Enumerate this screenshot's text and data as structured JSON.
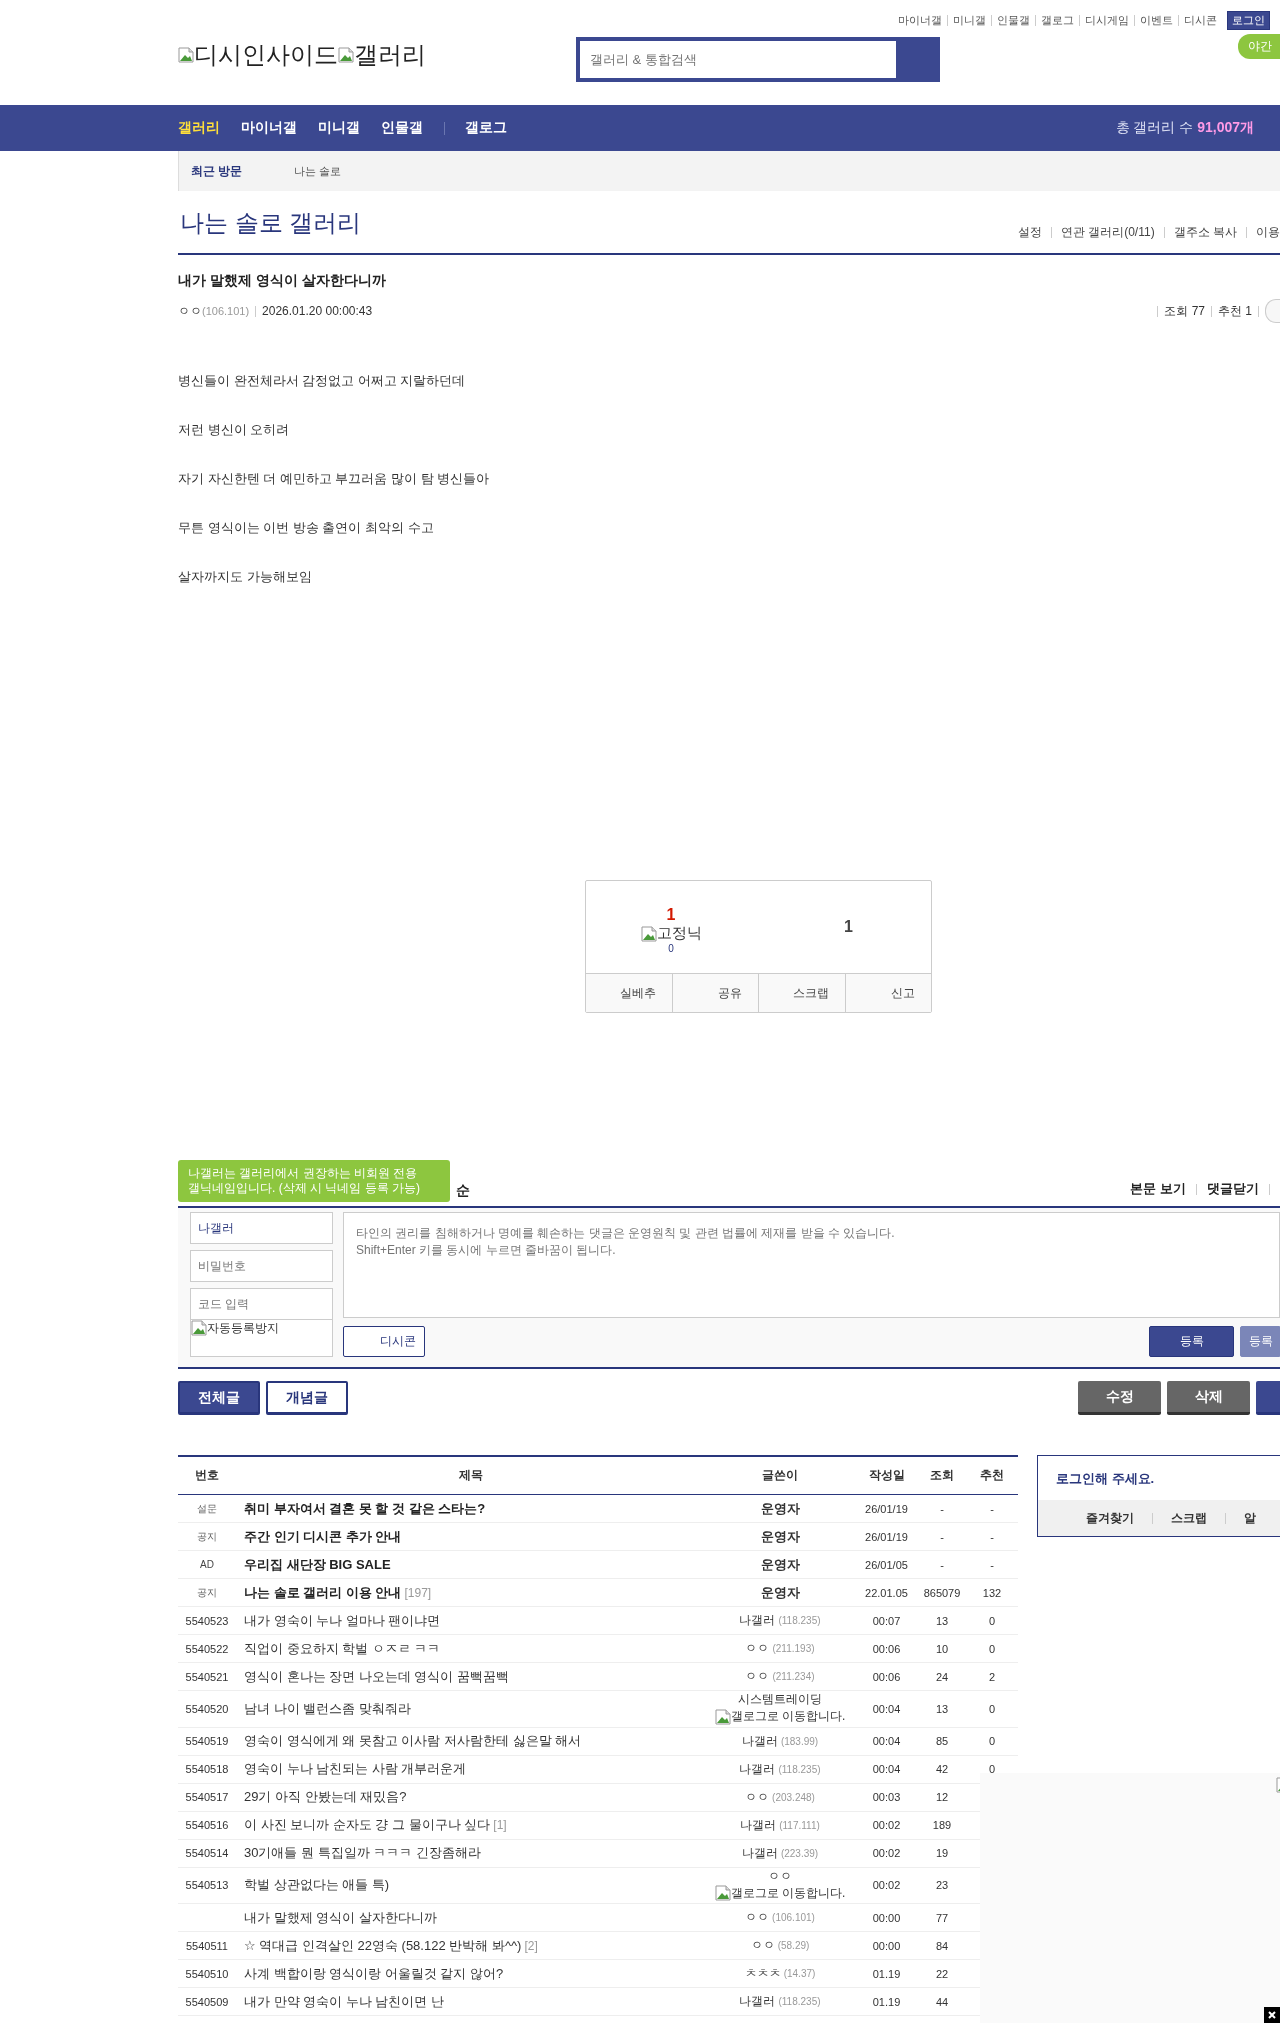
{
  "top_links": [
    {
      "label": "마이너갤"
    },
    {
      "label": "미니갤"
    },
    {
      "label": "인물갤"
    },
    {
      "label": "갤로그"
    },
    {
      "label": "디시게임"
    },
    {
      "label": "이벤트"
    },
    {
      "label": "디시콘"
    }
  ],
  "login_button": "로그인",
  "logo": {
    "site": "디시인사이드",
    "section": "갤러리"
  },
  "search": {
    "placeholder": "갤러리 & 통합검색"
  },
  "night_mode_button": "야간",
  "nav": {
    "groups": [
      {
        "items": [
          {
            "label": "갤러리",
            "selected": true
          },
          {
            "label": "마이너갤",
            "selected": false
          },
          {
            "label": "미니갤",
            "selected": false
          },
          {
            "label": "인물갤",
            "selected": false
          }
        ]
      },
      {
        "items": [
          {
            "label": "갤로그",
            "selected": false
          }
        ]
      }
    ],
    "total_label": "총 갤러리 수",
    "total_count": "91,007개"
  },
  "recent": {
    "label": "최근 방문",
    "items": [
      "나는 솔로"
    ]
  },
  "gallery": {
    "title": "나는 솔로 갤러리",
    "links": [
      "설정",
      "연관 갤러리(0/11)",
      "갤주소 복사",
      "이용"
    ]
  },
  "post": {
    "title": "내가 말했제 영식이 살자한다니까",
    "writer": "ㅇㅇ",
    "ip": "(106.101)",
    "date": "2026.01.20 00:00:43",
    "views_label": "조회 77",
    "recommend_label": "추천 1",
    "paragraphs": [
      "병신들이 완전체라서 감정없고 어쩌고 지랄하던데",
      "저런 병신이 오히려",
      "자기 자신한텐 더 예민하고 부끄러움 많이 탐 병신들아",
      "무튼 영식이는 이번 방송 출연이 최악의 수고",
      "살자까지도 가능해보임"
    ]
  },
  "vote": {
    "up_count": "1",
    "fixed_nick_alt": "고정닉",
    "fixed_nick_count": "0",
    "down_count": "1",
    "actions": [
      "실베추",
      "공유",
      "스크랩",
      "신고"
    ]
  },
  "comments": {
    "tooltip": "나갤러는 갤러리에서 권장하는 비회원 전용\n갤닉네임입니다. (삭제 시 닉네임 등록 가능)",
    "header_fragment": "순",
    "links": [
      "본문 보기",
      "댓글닫기"
    ],
    "nickname": "나갤러",
    "password_placeholder": "비밀번호",
    "code_placeholder": "코드 입력",
    "captcha_alt": "자동등록방지",
    "textarea_placeholder": "타인의 권리를 침해하거나 명예를 훼손하는 댓글은 운영원칙 및 관련 법률에 제재를 받을 수 있습니다.\nShift+Enter 키를 동시에 누르면 줄바꿈이 됩니다.",
    "dccon_button": "디시콘",
    "submit_buttons": [
      {
        "label": "등록",
        "kind": "primary"
      },
      {
        "label": "등록",
        "kind": "secondary"
      }
    ]
  },
  "list_tabs": [
    {
      "label": "전체글",
      "selected": true
    },
    {
      "label": "개념글",
      "selected": false
    }
  ],
  "list_actions": [
    {
      "label": "수정",
      "kind": "gray"
    },
    {
      "label": "삭제",
      "kind": "gray"
    },
    {
      "kind": "primary"
    }
  ],
  "table": {
    "columns": [
      "번호",
      "제목",
      "글쓴이",
      "작성일",
      "조회",
      "추천"
    ],
    "pinned_rows": [
      {
        "kind": "survey",
        "number": "설문",
        "title": "취미 부자여서 결혼 못 할 것 같은 스타는?",
        "writer": "운영자",
        "date": "26/01/19",
        "views": "-",
        "recommends": "-"
      },
      {
        "kind": "notice",
        "number": "공지",
        "title": "주간 인기 디시콘 추가 안내",
        "writer": "운영자",
        "date": "26/01/19",
        "views": "-",
        "recommends": "-"
      },
      {
        "kind": "ad",
        "number": "AD",
        "title": "우리집 새단장 BIG SALE",
        "writer": "운영자",
        "date": "26/01/05",
        "views": "-",
        "recommends": "-"
      },
      {
        "kind": "notice",
        "number": "공지",
        "title": "나는 솔로 갤러리 이용 안내",
        "reply_count": "[197]",
        "writer": "운영자",
        "date": "22.01.05",
        "views": "865079",
        "recommends": "132"
      }
    ],
    "rows": [
      {
        "number": "5540523",
        "title": "내가 영숙이 누나 얼마나 팬이냐면",
        "writer": "나갤러",
        "ip": "(118.235)",
        "date": "00:07",
        "views": "13",
        "recommends": "0"
      },
      {
        "number": "5540522",
        "title": "직업이 중요하지 학벌 ㅇㅈㄹ ㅋㅋ",
        "writer": "ㅇㅇ",
        "ip": "(211.193)",
        "date": "00:06",
        "views": "10",
        "recommends": "0"
      },
      {
        "number": "5540521",
        "title": "영식이 혼나는 장면 나오는데 영식이 꿈뻑꿈뻑",
        "writer": "ㅇㅇ",
        "ip": "(211.234)",
        "date": "00:06",
        "views": "24",
        "recommends": "2"
      },
      {
        "number": "5540520",
        "title": "남녀 나이 밸런스좀 맞춰줘라",
        "writer": "시스템트레이딩",
        "gallog_alt": "갤로그로 이동합니다.",
        "date": "00:04",
        "views": "13",
        "recommends": "0"
      },
      {
        "number": "5540519",
        "title": "영숙이 영식에게 왜 못참고 이사람 저사람한테 싫은말 해서",
        "writer": "나갤러",
        "ip": "(183.99)",
        "date": "00:04",
        "views": "85",
        "recommends": "0"
      },
      {
        "number": "5540518",
        "title": "영숙이 누나 남친되는 사람 개부러운게",
        "writer": "나갤러",
        "ip": "(118.235)",
        "date": "00:04",
        "views": "42",
        "recommends": "0"
      },
      {
        "number": "5540517",
        "title": "29기 아직 안봤는데 재밌음?",
        "writer": "ㅇㅇ",
        "ip": "(203.248)",
        "date": "00:03",
        "views": "12"
      },
      {
        "number": "5540516",
        "title": "이 사진 보니까 순자도 걍 그 물이구나 싶다",
        "reply_count": "[1]",
        "writer": "나갤러",
        "ip": "(117.111)",
        "date": "00:02",
        "views": "189"
      },
      {
        "number": "5540514",
        "title": "30기애들 뭔 특집일까 ㅋㅋㅋ 긴장좀해라",
        "writer": "나갤러",
        "ip": "(223.39)",
        "date": "00:02",
        "views": "19"
      },
      {
        "number": "5540513",
        "title": "학벌 상관없다는 애들 특)",
        "writer": "ㅇㅇ",
        "gallog_alt": "갤로그로 이동합니다.",
        "date": "00:02",
        "views": "23"
      },
      {
        "title": "내가 말했제 영식이 살자한다니까",
        "writer": "ㅇㅇ",
        "ip": "(106.101)",
        "date": "00:00",
        "views": "77"
      },
      {
        "number": "5540511",
        "title": "☆ 역대급 인격살인 22영숙 (58.122 반박해 봐^^)",
        "reply_count": "[2]",
        "writer": "ㅇㅇ",
        "ip": "(58.29)",
        "date": "00:00",
        "views": "84"
      },
      {
        "number": "5540510",
        "title": "사계 백합이랑 영식이랑 어울릴것 같지 않어?",
        "writer": "ㅊㅊㅊ",
        "ip": "(14.37)",
        "date": "01.19",
        "views": "22"
      },
      {
        "number": "5540509",
        "title": "내가 만약 영숙이 누나 남친이면 난",
        "writer": "나갤러",
        "ip": "(118.235)",
        "date": "01.19",
        "views": "44"
      }
    ]
  },
  "login_box": {
    "message": "로그인해 주세요.",
    "links": [
      "즐겨찾기",
      "스크랩",
      "알"
    ]
  }
}
